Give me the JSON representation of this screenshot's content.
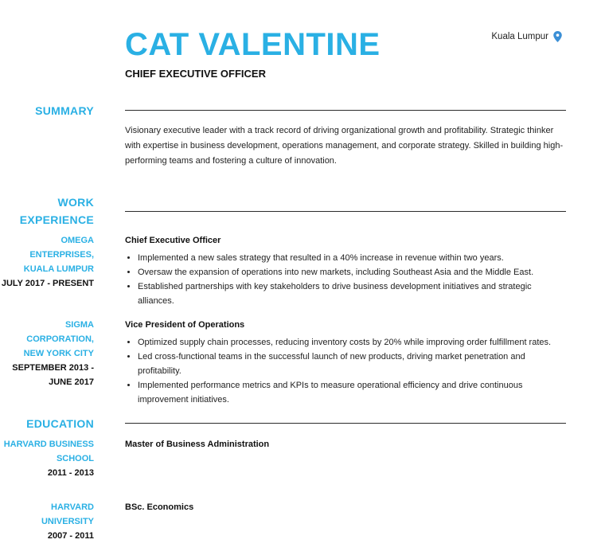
{
  "header": {
    "name": "CAT VALENTINE",
    "title": "CHIEF EXECUTIVE OFFICER",
    "location": "Kuala Lumpur",
    "location_icon": "map-pin-icon",
    "accent_color": "#2ab0e4"
  },
  "summary": {
    "heading": "SUMMARY",
    "text": "Visionary executive leader with a track record of driving organizational growth and profitability. Strategic thinker with expertise in business development, operations management, and corporate strategy. Skilled in building high-performing teams and fostering a culture of innovation."
  },
  "work": {
    "heading_line1": "WORK",
    "heading_line2": "EXPERIENCE",
    "jobs": [
      {
        "org_line1": "OMEGA ENTERPRISES,",
        "org_line2": "KUALA LUMPUR",
        "dates_line1": "JULY 2017 - PRESENT",
        "dates_line2": "",
        "role": "Chief Executive Officer",
        "bullets": [
          "Implemented a new sales strategy that resulted in a 40% increase in revenue within two years.",
          "Oversaw the expansion of operations into new markets, including Southeast Asia and the Middle East.",
          "Established partnerships with key stakeholders to drive business development initiatives and strategic alliances."
        ]
      },
      {
        "org_line1": "SIGMA CORPORATION,",
        "org_line2": "NEW YORK CITY",
        "dates_line1": "SEPTEMBER 2013 -",
        "dates_line2": "JUNE 2017",
        "role": "Vice President of Operations",
        "bullets": [
          "Optimized supply chain processes, reducing inventory costs by 20% while improving order fulfillment rates.",
          "Led cross-functional teams in the successful launch of new products, driving market penetration and profitability.",
          "Implemented performance metrics and KPIs to measure operational efficiency and drive continuous improvement initiatives."
        ]
      }
    ]
  },
  "education": {
    "heading": "EDUCATION",
    "entries": [
      {
        "school_line1": "HARVARD BUSINESS",
        "school_line2": "SCHOOL",
        "dates": "2011 - 2013",
        "degree": "Master of Business Administration"
      },
      {
        "school_line1": "HARVARD UNIVERSITY",
        "school_line2": "",
        "dates": "2007 - 2011",
        "degree": "BSc. Economics"
      }
    ]
  }
}
